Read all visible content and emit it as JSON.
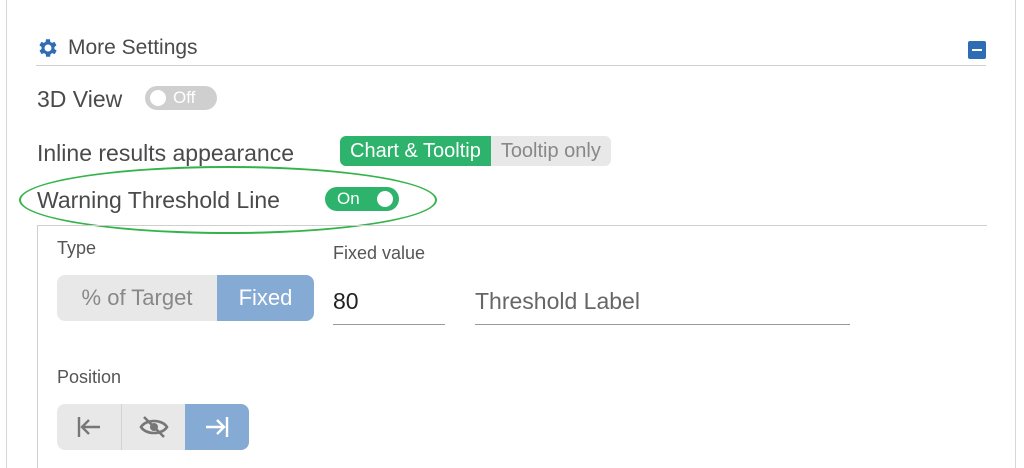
{
  "section": {
    "title": "More Settings",
    "icon": "gear-icon",
    "collapse_icon": "minus-icon"
  },
  "view3d": {
    "label": "3D View",
    "toggle_label": "Off",
    "state": "off"
  },
  "inline_results": {
    "label": "Inline results appearance",
    "options": [
      "Chart & Tooltip",
      "Tooltip only"
    ],
    "selected": "Chart & Tooltip"
  },
  "warning_threshold": {
    "label": "Warning Threshold Line",
    "toggle_label": "On",
    "state": "on",
    "highlight_color": "#34b34a"
  },
  "threshold": {
    "type_label": "Type",
    "type_options": [
      "% of Target",
      "Fixed"
    ],
    "type_selected": "Fixed",
    "fixed_value_label": "Fixed value",
    "fixed_value": "80",
    "threshold_label_placeholder": "Threshold Label",
    "position_label": "Position",
    "position_options": [
      "left-arrow-icon",
      "eye-off-icon",
      "right-arrow-icon"
    ],
    "position_selected": "right-arrow-icon"
  },
  "colors": {
    "accent_green": "#2db36b",
    "accent_blue": "#85aad3",
    "header_blue": "#2e6db3"
  }
}
